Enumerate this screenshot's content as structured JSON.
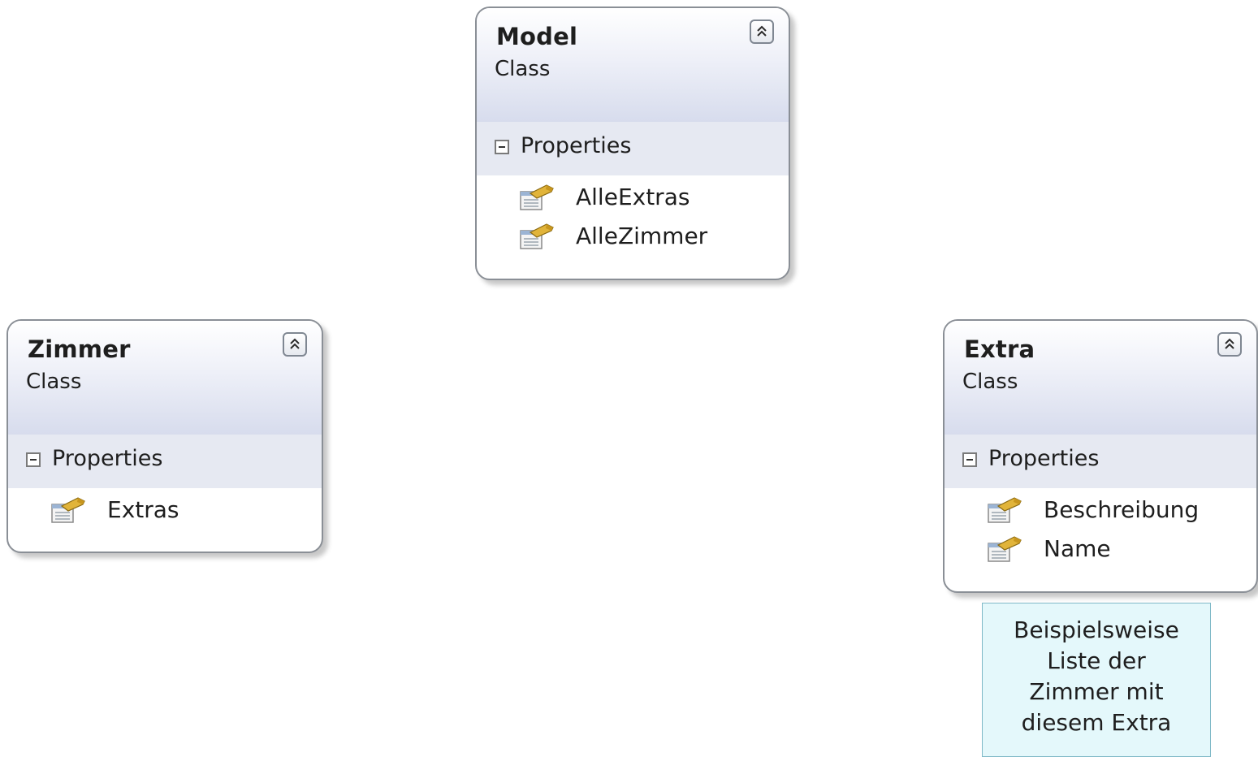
{
  "classes": {
    "model": {
      "name": "Model",
      "kind": "Class",
      "section": "Properties",
      "properties": [
        "AlleExtras",
        "AlleZimmer"
      ]
    },
    "zimmer": {
      "name": "Zimmer",
      "kind": "Class",
      "section": "Properties",
      "properties": [
        "Extras"
      ]
    },
    "extra": {
      "name": "Extra",
      "kind": "Class",
      "section": "Properties",
      "properties": [
        "Beschreibung",
        "Name"
      ]
    }
  },
  "note": {
    "lines": [
      "Beispielsweise",
      "Liste der",
      "Zimmer mit",
      "diesem Extra"
    ]
  },
  "icons": {
    "collapse": "double-chevron-up-icon",
    "section_toggle": "minus-box-icon",
    "property": "property-icon"
  },
  "colors": {
    "note_background": "#e4f8fb",
    "note_border": "#7fb9c7",
    "header_gradient_end": "#d7dced",
    "section_background": "#e6e9f2"
  }
}
